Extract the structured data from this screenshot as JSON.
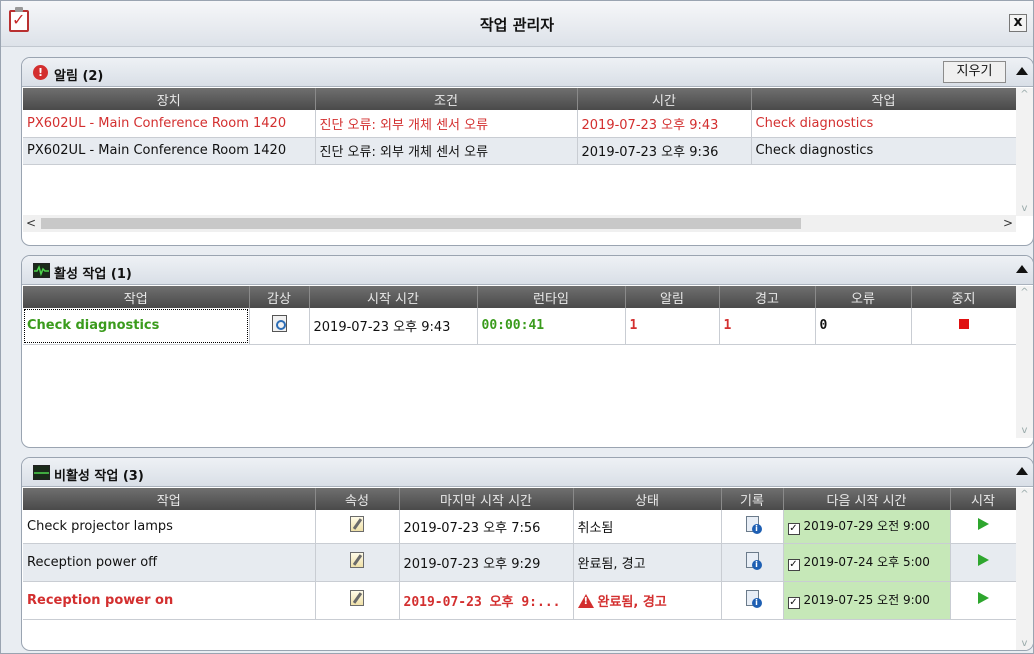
{
  "window": {
    "title": "작업 관리자",
    "close_label": "x"
  },
  "alerts": {
    "title": "알림 (2)",
    "clear_label": "지우기",
    "columns": [
      "장치",
      "조건",
      "시간",
      "작업"
    ],
    "rows": [
      {
        "device": "PX602UL - Main Conference Room 1420",
        "condition": "진단 오류: 외부 개체 센서 오류",
        "time": "2019-07-23 오후 9:43",
        "task": "Check diagnostics",
        "highlight": true
      },
      {
        "device": "PX602UL - Main Conference Room 1420",
        "condition": "진단 오류: 외부 개체 센서 오류",
        "time": "2019-07-23 오후 9:36",
        "task": "Check diagnostics",
        "highlight": false
      }
    ]
  },
  "active": {
    "title": "활성 작업 (1)",
    "columns": [
      "작업",
      "감상",
      "시작 시간",
      "런타임",
      "알림",
      "경고",
      "오류",
      "중지"
    ],
    "rows": [
      {
        "task": "Check diagnostics",
        "start": "2019-07-23 오후 9:43",
        "runtime": "00:00:41",
        "alerts": "1",
        "warnings": "1",
        "errors": "0"
      }
    ]
  },
  "inactive": {
    "title": "비활성 작업 (3)",
    "columns": [
      "작업",
      "속성",
      "마지막 시작 시간",
      "상태",
      "기록",
      "다음 시작 시간",
      "시작"
    ],
    "rows": [
      {
        "task": "Check projector lamps",
        "last": "2019-07-23 오후 7:56",
        "status": "취소됨",
        "next": "2019-07-29 오전 9:00",
        "error": false
      },
      {
        "task": "Reception power off",
        "last": "2019-07-23 오후 9:29",
        "status": "완료됨, 경고",
        "next": "2019-07-24 오후 5:00",
        "error": false
      },
      {
        "task": "Reception power on",
        "last": "2019-07-23 오후 9:...",
        "status": "완료됨, 경고",
        "next": "2019-07-25 오전 9:00",
        "error": true
      }
    ]
  },
  "colors": {
    "error_red": "#d32f2f",
    "runtime_green": "#3a9b1c",
    "schedule_bg": "#c6e8b8",
    "header_gray": "#5a5a5a"
  }
}
